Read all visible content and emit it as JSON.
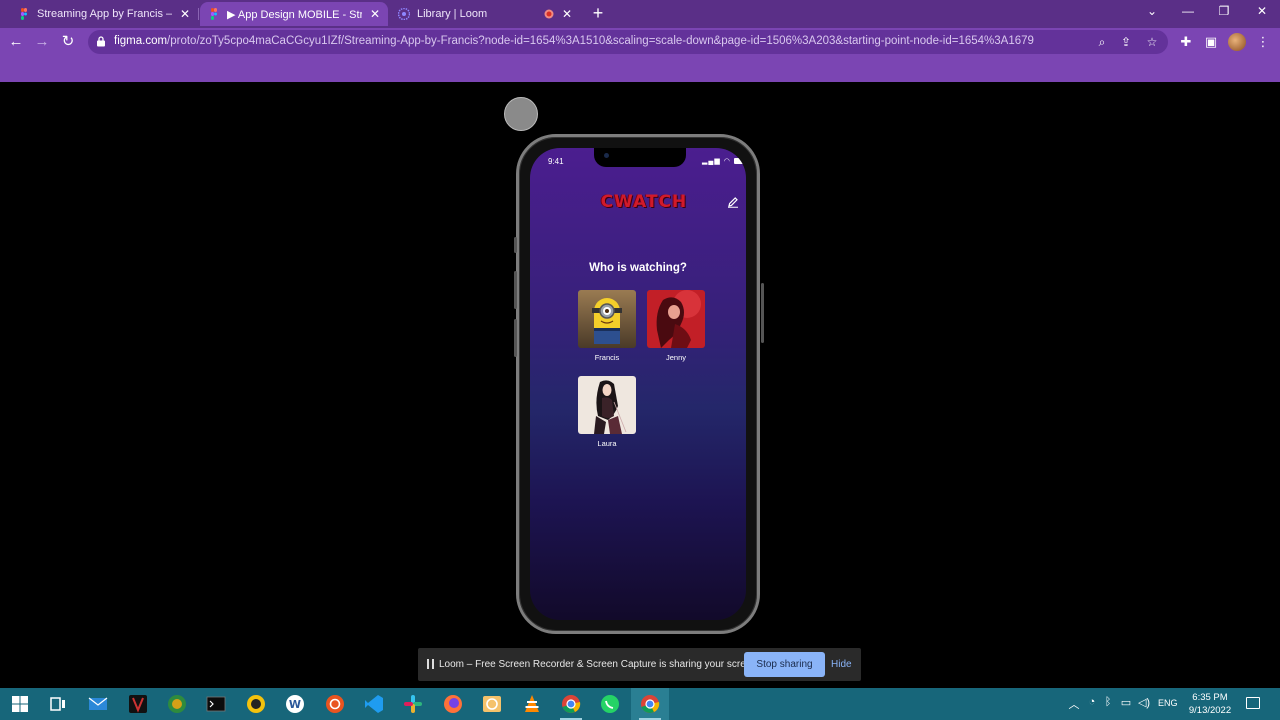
{
  "browser": {
    "tabs": [
      {
        "title": "Streaming App by Francis – Figma",
        "icon": "figma-icon",
        "active": false
      },
      {
        "title": "▶ App Design MOBILE - Streaming",
        "icon": "figma-icon",
        "active": true
      },
      {
        "title": "Library | Loom",
        "icon": "loom-icon",
        "active": false
      }
    ],
    "recording_indicator": "recording-icon",
    "new_tab": "+",
    "window_controls": {
      "minimize": "—",
      "restore": "❐",
      "close": "✕",
      "tab_search": "⌄"
    },
    "nav": {
      "back": "←",
      "forward": "→",
      "reload": "↻"
    },
    "url_host": "figma.com",
    "url_path": "/proto/zoTy5cpo4maCaCGcyu1IZf/Streaming-App-by-Francis?node-id=1654%3A1510&scaling=scale-down&page-id=1506%3A203&starting-point-node-id=1654%3A1679"
  },
  "app": {
    "status_time": "9:41",
    "logo": "CWATCH",
    "title": "Who is watching?",
    "profiles": [
      {
        "name": "Francis"
      },
      {
        "name": "Jenny"
      },
      {
        "name": "Laura"
      }
    ]
  },
  "loom": {
    "message": "Loom – Free Screen Recorder & Screen Capture is sharing your screen.",
    "stop_label": "Stop sharing",
    "hide_label": "Hide"
  },
  "taskbar": {
    "apps": [
      "windows-start-icon",
      "task-view-icon",
      "mail-icon",
      "game-icon",
      "xbox-icon",
      "terminal-icon",
      "norton-icon",
      "word-icon",
      "ubuntu-icon",
      "vscode-icon",
      "slack-icon",
      "firefox-icon",
      "photo-icon",
      "vlc-icon",
      "chrome-icon",
      "whatsapp-icon",
      "chrome-icon"
    ],
    "language": "ENG",
    "time": "6:35 PM",
    "date": "9/13/2022"
  },
  "colors": {
    "browser_frame": "#5a2f87",
    "browser_toolbar": "#7b45b3",
    "loom_button": "#8ab4f8",
    "taskbar": "#17667a",
    "logo_red": "#d11a2a"
  }
}
